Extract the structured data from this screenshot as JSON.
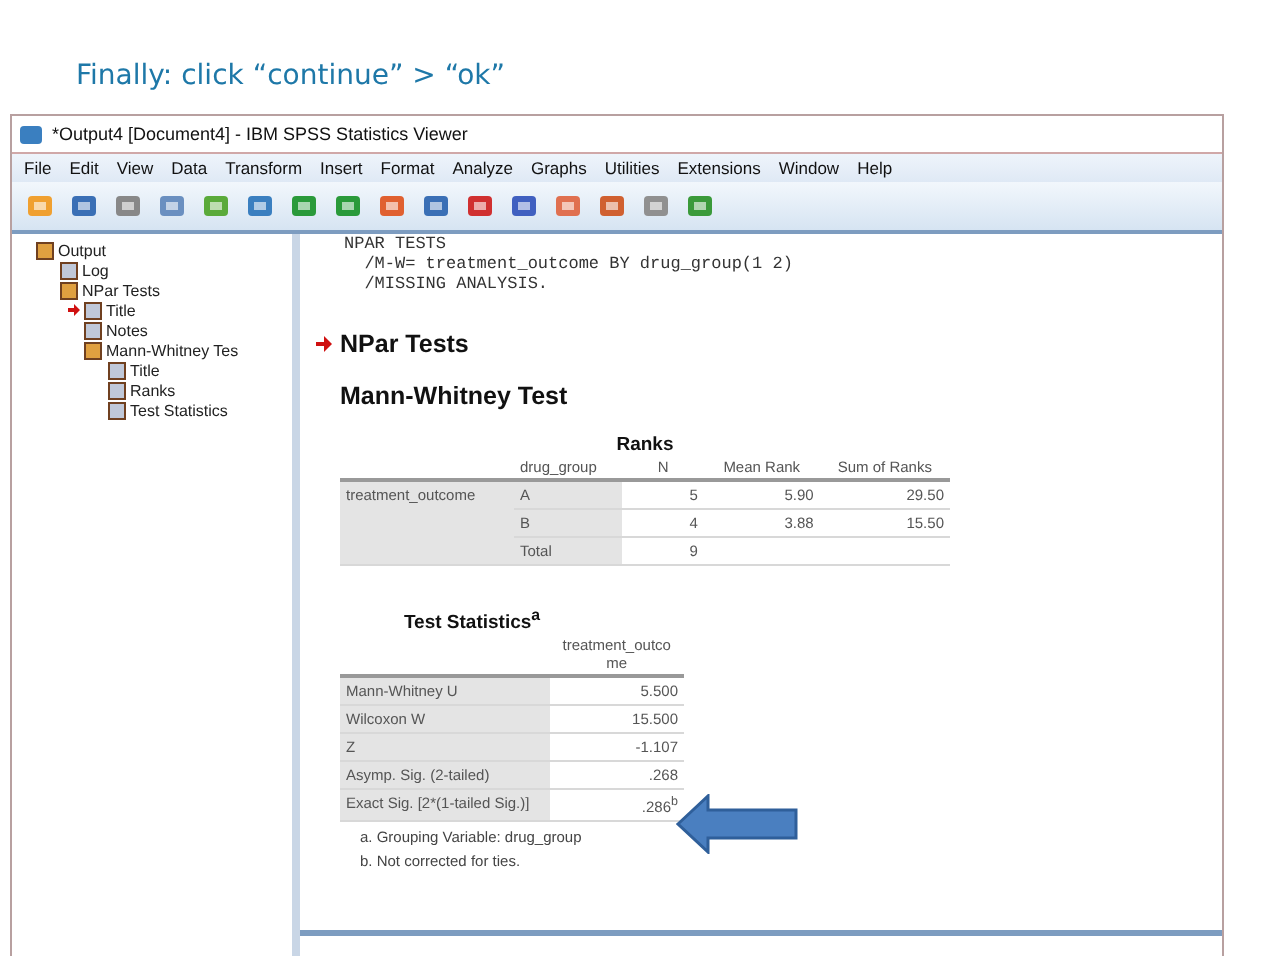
{
  "slide_heading": "Finally: click “continue” > “ok”",
  "window": {
    "title": "*Output4 [Document4] - IBM SPSS Statistics Viewer"
  },
  "menu": [
    "File",
    "Edit",
    "View",
    "Data",
    "Transform",
    "Insert",
    "Format",
    "Analyze",
    "Graphs",
    "Utilities",
    "Extensions",
    "Window",
    "Help"
  ],
  "tree": [
    {
      "label": "Output",
      "current": false,
      "children": [
        {
          "label": "Log",
          "current": false
        },
        {
          "label": "NPar Tests",
          "current": false,
          "children": [
            {
              "label": "Title",
              "current": true
            },
            {
              "label": "Notes",
              "current": false
            },
            {
              "label": "Mann-Whitney Tes",
              "current": false,
              "children": [
                {
                  "label": "Title",
                  "current": false
                },
                {
                  "label": "Ranks",
                  "current": false
                },
                {
                  "label": "Test Statistics",
                  "current": false
                }
              ]
            }
          ]
        }
      ]
    }
  ],
  "syntax": [
    "NPAR TESTS",
    "  /M-W= treatment_outcome BY drug_group(1 2)",
    "  /MISSING ANALYSIS."
  ],
  "section_title": "NPar Tests",
  "test_title": "Mann-Whitney Test",
  "ranks": {
    "title": "Ranks",
    "columns": [
      "drug_group",
      "N",
      "Mean Rank",
      "Sum of Ranks"
    ],
    "variable": "treatment_outcome",
    "rows": [
      {
        "group": "A",
        "n": "5",
        "mean_rank": "5.90",
        "sum_of_ranks": "29.50"
      },
      {
        "group": "B",
        "n": "4",
        "mean_rank": "3.88",
        "sum_of_ranks": "15.50"
      },
      {
        "group": "Total",
        "n": "9"
      }
    ]
  },
  "test_statistics": {
    "title": "Test Statistics$^{a}$",
    "column": "treatment_outcome",
    "rows": [
      {
        "label": "Mann-Whitney U",
        "value": "5.500"
      },
      {
        "label": "Wilcoxon W",
        "value": "15.500"
      },
      {
        "label": "Z",
        "value": "-1.107"
      },
      {
        "label": "Asymp. Sig. (2-tailed)",
        "value": ".268"
      },
      {
        "label": "Exact Sig. [2*(1-tailed Sig.)]",
        "value": ".286$^{b}$"
      }
    ],
    "footnotes": [
      "a. Grouping Variable: drug_group",
      "b. Not corrected for ties."
    ]
  }
}
